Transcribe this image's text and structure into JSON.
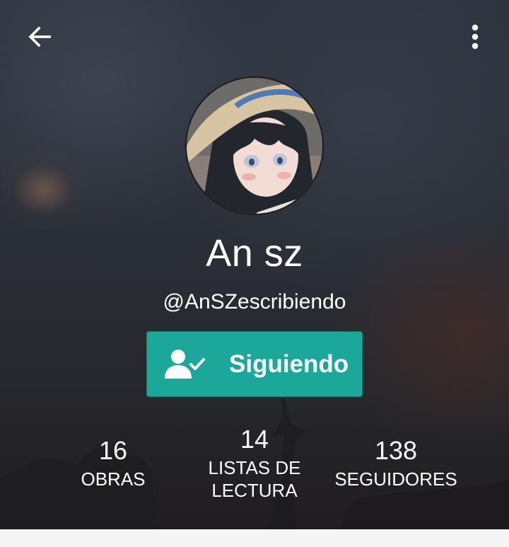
{
  "topbar": {
    "back_icon": "arrow-left-icon",
    "menu_icon": "more-vertical-icon"
  },
  "profile": {
    "display_name": "An sz",
    "username": "@AnSZescribiendo"
  },
  "follow_button": {
    "label": "Siguiendo",
    "icon": "user-check-icon",
    "color": "#1ba89a"
  },
  "stats": [
    {
      "value": "16",
      "label": "OBRAS"
    },
    {
      "value": "14",
      "label": "LISTAS DE LECTURA"
    },
    {
      "value": "138",
      "label": "SEGUIDORES"
    }
  ]
}
